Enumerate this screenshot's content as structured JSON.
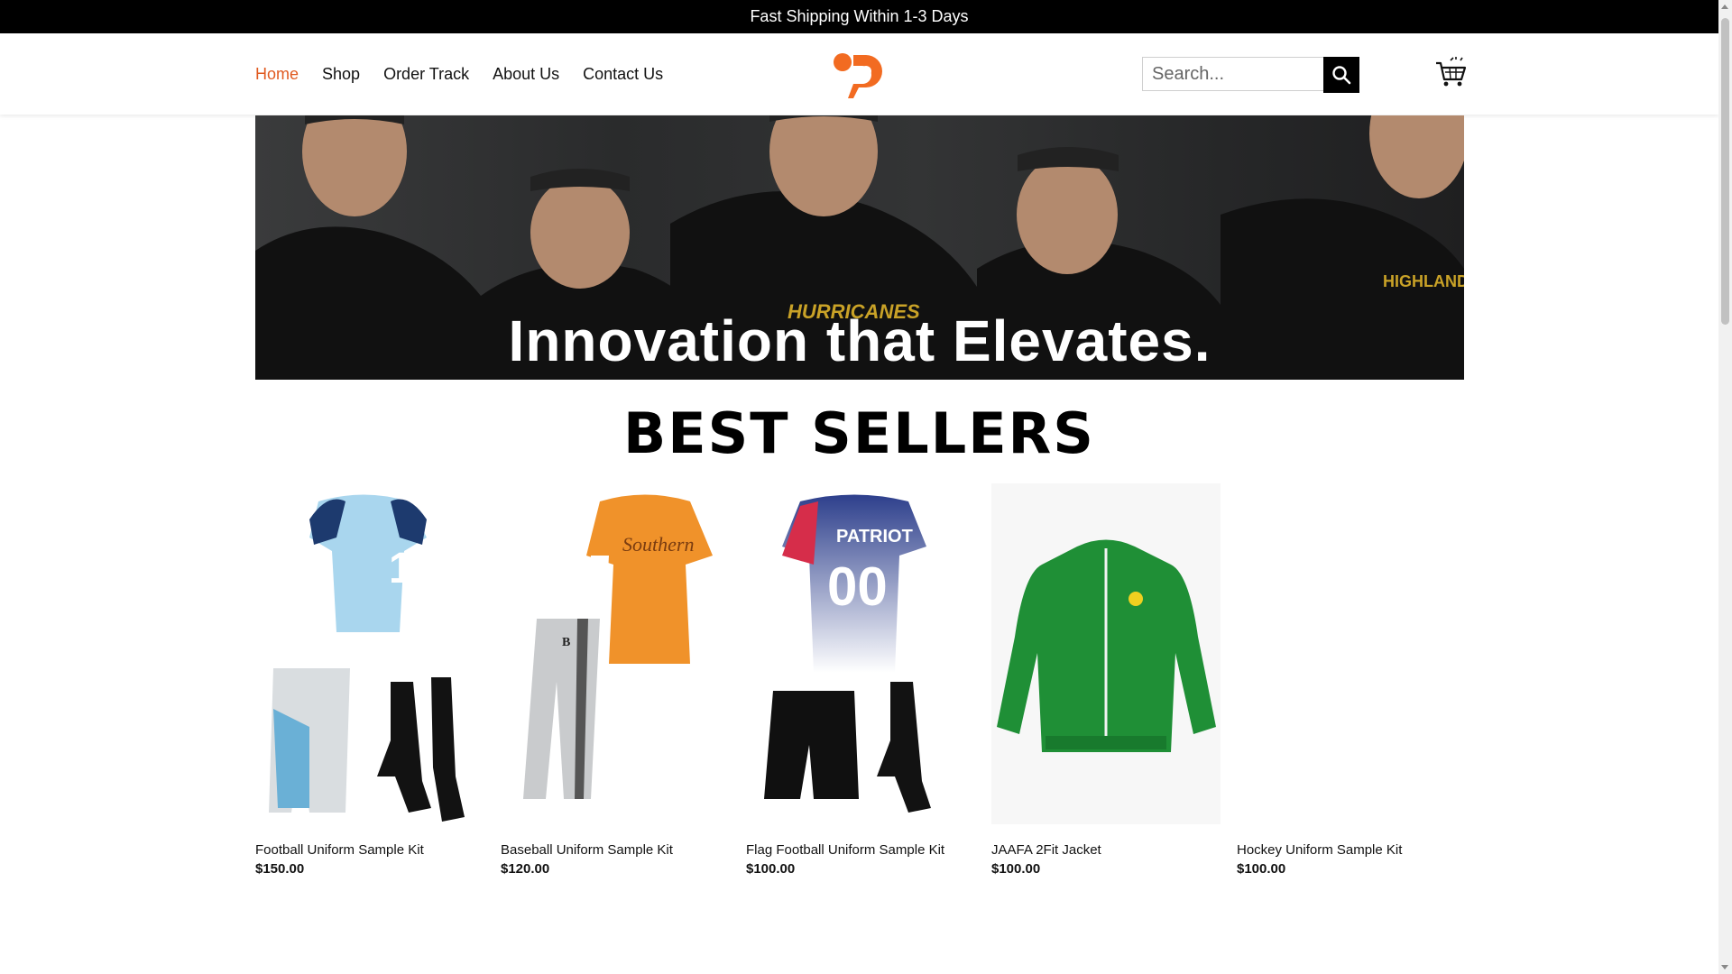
{
  "announcement": {
    "text": "Fast Shipping Within 1-3 Days"
  },
  "nav": {
    "items": [
      {
        "label": "Home",
        "active": true
      },
      {
        "label": "Shop"
      },
      {
        "label": "Order Track"
      },
      {
        "label": "About Us"
      },
      {
        "label": "Contact Us"
      }
    ]
  },
  "search": {
    "placeholder": "Search..."
  },
  "banner": {
    "headline": "Innovation that  Elevates."
  },
  "best_sellers": {
    "title": "BEST SELLERS",
    "products": [
      {
        "name": "Football Uniform Sample Kit",
        "price": "$150.00"
      },
      {
        "name": "Baseball Uniform Sample Kit",
        "price": "$120.00"
      },
      {
        "name": "Flag Football Uniform Sample Kit",
        "price": "$100.00"
      },
      {
        "name": "JAAFA 2Fit Jacket",
        "price": "$100.00"
      },
      {
        "name": "Hockey Uniform Sample Kit",
        "price": "$100.00"
      }
    ]
  },
  "colors": {
    "accent": "#e05a20",
    "brand_orange": "#f26b21",
    "jacket_green": "#1f8f36"
  },
  "icons": {
    "search": "search-icon",
    "cart": "cart-icon",
    "logo": "brand-logo"
  }
}
